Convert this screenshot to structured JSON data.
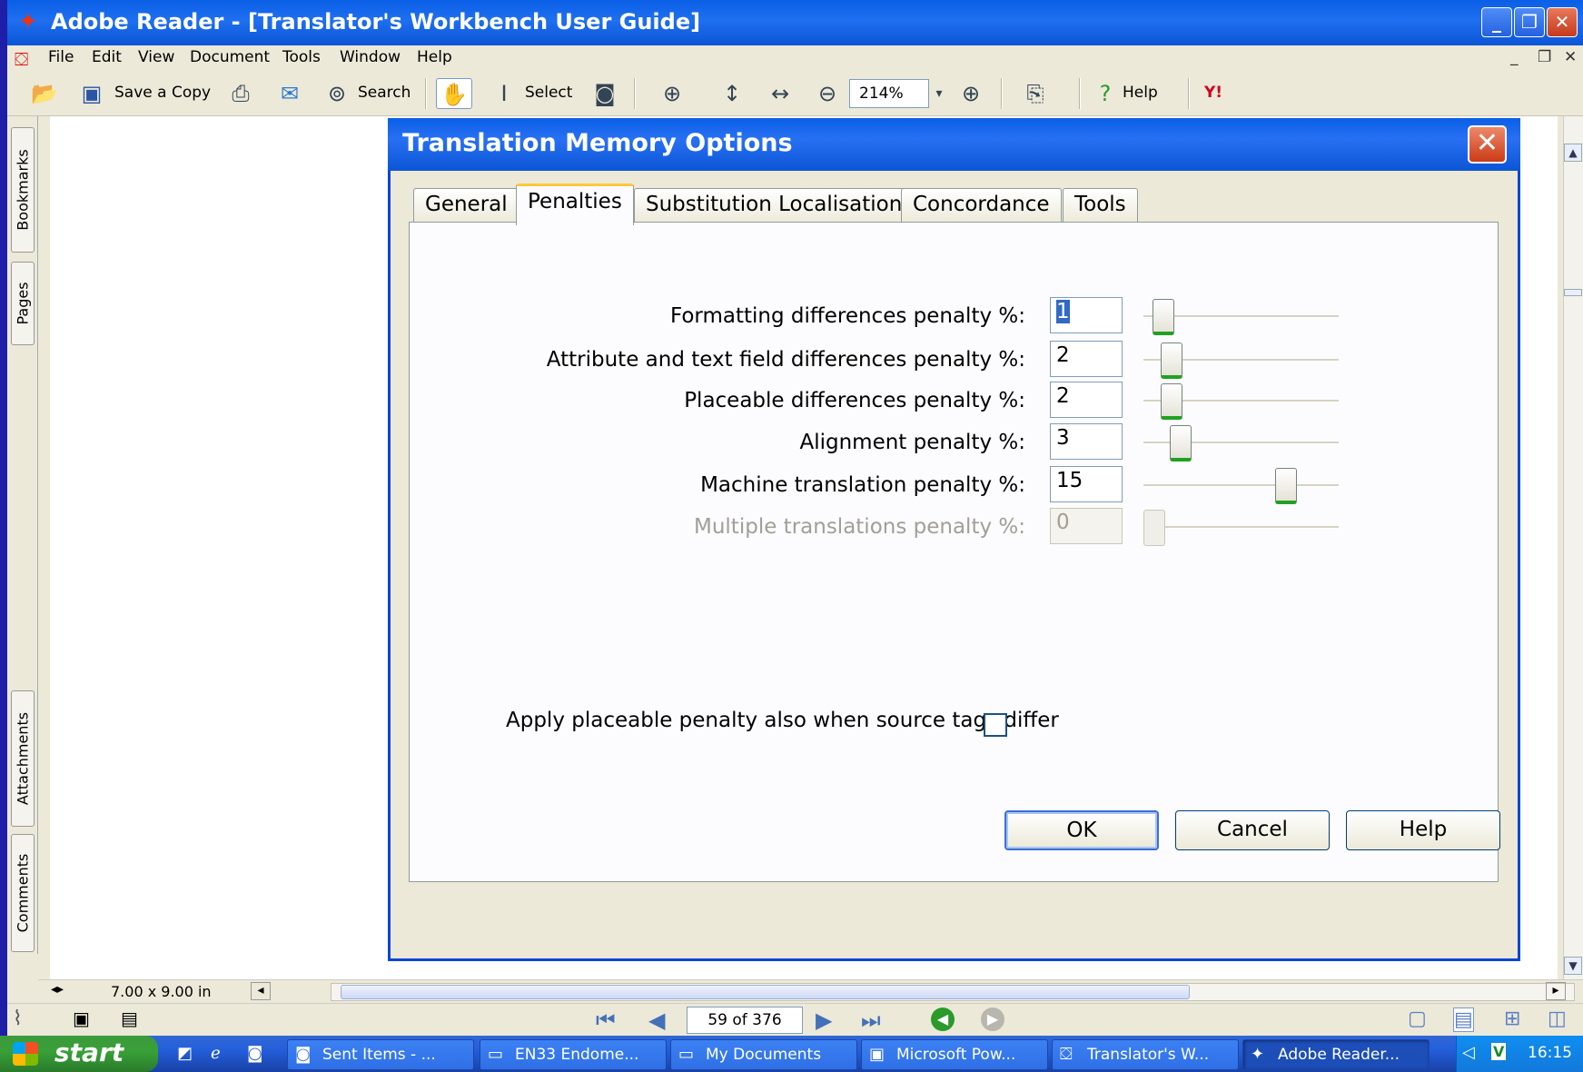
{
  "window": {
    "title": "Adobe Reader - [Translator's Workbench User Guide]",
    "buttons": [
      "_",
      "❐",
      "✕"
    ]
  },
  "menu": [
    "File",
    "Edit",
    "View",
    "Document",
    "Tools",
    "Window",
    "Help"
  ],
  "toolbar": {
    "save_copy": "Save a Copy",
    "search": "Search",
    "select": "Select",
    "zoom": "214%",
    "help": "Help",
    "yahoo": "Y!"
  },
  "nav_tabs": [
    "Bookmarks",
    "Pages",
    "Attachments",
    "Comments"
  ],
  "status": {
    "page_size": "7.00 x 9.00 in",
    "page_indicator": "59 of 376"
  },
  "dialog": {
    "title": "Translation Memory Options",
    "tabs": [
      "General",
      "Penalties",
      "Substitution Localisation",
      "Concordance",
      "Tools"
    ],
    "active_tab": "Penalties",
    "fields": [
      {
        "label": "Formatting differences penalty %:",
        "value": "1",
        "slider_level": 1,
        "enabled": true
      },
      {
        "label": "Attribute and text field differences penalty %:",
        "value": "2",
        "slider_level": 2,
        "enabled": true
      },
      {
        "label": "Placeable differences penalty %:",
        "value": "2",
        "slider_level": 2,
        "enabled": true
      },
      {
        "label": "Alignment penalty %:",
        "value": "3",
        "slider_level": 3,
        "enabled": true
      },
      {
        "label": "Machine translation penalty %:",
        "value": "15",
        "slider_level": 15,
        "enabled": true
      },
      {
        "label": "Multiple translations penalty %:",
        "value": "0",
        "slider_level": 0,
        "enabled": false
      }
    ],
    "checkbox_label": "Apply placeable penalty also when source tags differ",
    "checkbox_checked": false,
    "buttons": {
      "ok": "OK",
      "cancel": "Cancel",
      "help": "Help"
    }
  },
  "taskbar": {
    "start": "start",
    "items": [
      {
        "label": "Sent Items - ...",
        "icon": "outlook-icon"
      },
      {
        "label": "EN33 Endome...",
        "icon": "folder-icon"
      },
      {
        "label": "My Documents",
        "icon": "folder-icon"
      },
      {
        "label": "Microsoft Pow...",
        "icon": "powerpoint-icon"
      },
      {
        "label": "Translator's W...",
        "icon": "pdf-icon"
      },
      {
        "label": "Adobe Reader...",
        "icon": "adobe-reader-icon"
      }
    ],
    "clock": "16:15"
  },
  "colors": {
    "title_blue": "#0a5fe6",
    "slider_accent": "#21a121",
    "close_red": "#cc3a17"
  }
}
